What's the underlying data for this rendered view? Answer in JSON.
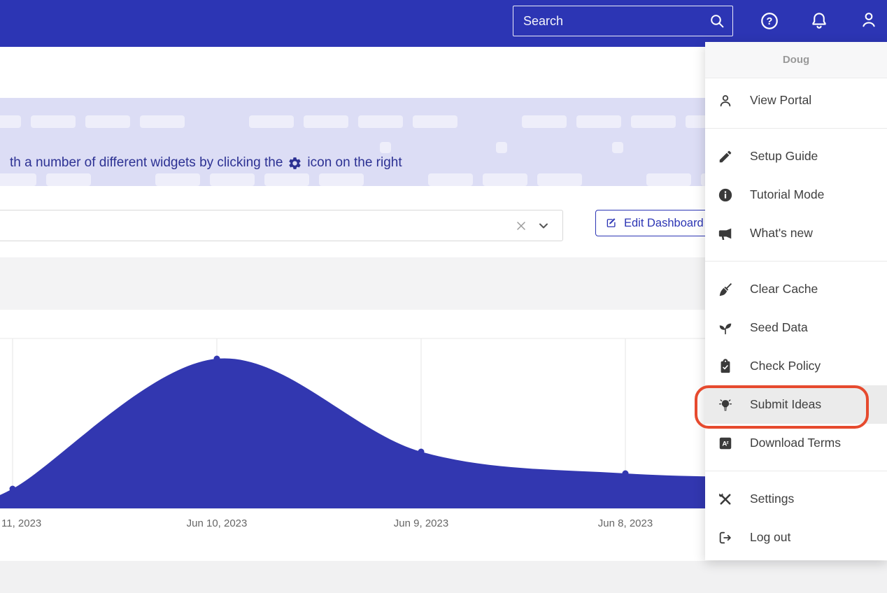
{
  "topbar": {
    "search_placeholder": "Search",
    "search_value": ""
  },
  "banner": {
    "text_before_icon": "th a number of different widgets by clicking the",
    "icon": "gear-icon",
    "text_after_icon": "icon on the right"
  },
  "dashboard_bar": {
    "select_value": "",
    "edit_button_label": "Edit Dashboard"
  },
  "menu": {
    "header": "Doug",
    "groups": [
      {
        "items": [
          {
            "label": "View Portal",
            "icon": "user-outline-icon"
          }
        ]
      },
      {
        "items": [
          {
            "label": "Setup Guide",
            "icon": "pencil-icon"
          },
          {
            "label": "Tutorial Mode",
            "icon": "info-circle-icon"
          },
          {
            "label": "What's new",
            "icon": "bullhorn-icon"
          }
        ]
      },
      {
        "items": [
          {
            "label": "Clear Cache",
            "icon": "broom-icon"
          },
          {
            "label": "Seed Data",
            "icon": "seedling-icon"
          },
          {
            "label": "Check Policy",
            "icon": "clipboard-check-icon"
          },
          {
            "label": "Submit Ideas",
            "icon": "lightbulb-icon",
            "highlighted": true
          },
          {
            "label": "Download Terms",
            "icon": "font-box-icon"
          }
        ]
      },
      {
        "items": [
          {
            "label": "Settings",
            "icon": "tools-icon"
          },
          {
            "label": "Log out",
            "icon": "logout-icon"
          }
        ]
      }
    ]
  },
  "annotation": {
    "shape": "rounded-rect-outline",
    "color": "#e64a2e",
    "around": "Submit Ideas"
  },
  "chart_data": {
    "type": "area",
    "title": "",
    "xlabel": "",
    "ylabel": "",
    "categories": [
      "11, 2023",
      "Jun 10, 2023",
      "Jun 9, 2023",
      "Jun 8, 2023"
    ],
    "values": [
      28,
      214,
      81,
      50
    ],
    "ylim": [
      0,
      243
    ],
    "grid": true,
    "legend": false,
    "area_color": "#3237b0",
    "marker_color": "#3237b0"
  }
}
